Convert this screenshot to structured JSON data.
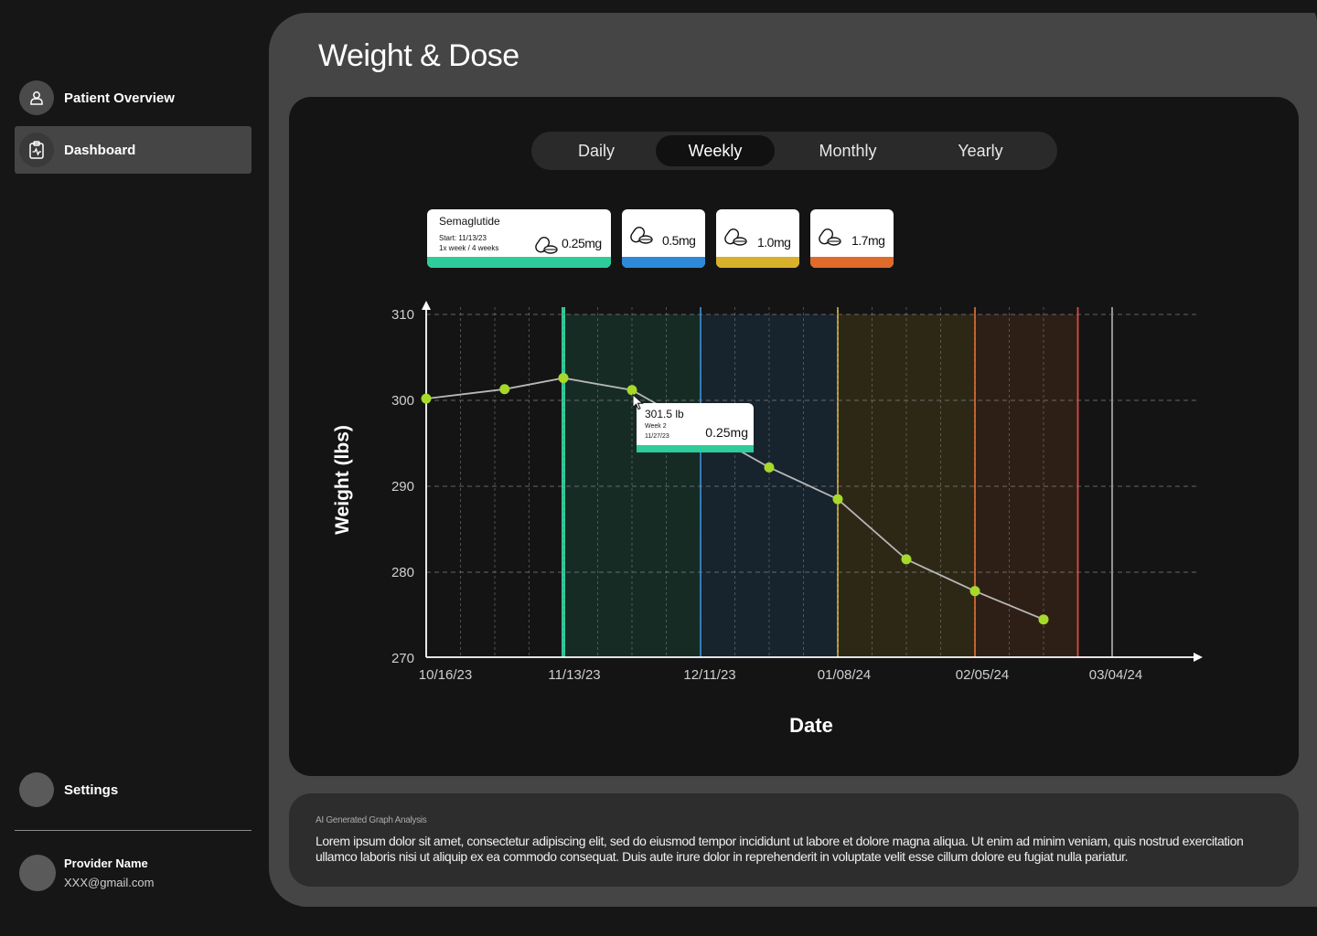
{
  "sidebar": {
    "items": [
      {
        "label": "Patient Overview",
        "icon": "person-icon"
      },
      {
        "label": "Dashboard",
        "icon": "clipboard-icon"
      }
    ],
    "settings_label": "Settings",
    "provider": {
      "name": "Provider Name",
      "email": "XXX@gmail.com"
    }
  },
  "page": {
    "title": "Weight & Dose"
  },
  "tabs": [
    {
      "label": "Daily",
      "active": false
    },
    {
      "label": "Weekly",
      "active": true
    },
    {
      "label": "Monthly",
      "active": false
    },
    {
      "label": "Yearly",
      "active": false
    }
  ],
  "doses": {
    "drug": "Semaglutide",
    "start": "Start: 11/13/23",
    "schedule": "1x week / 4 weeks",
    "levels": [
      {
        "amount": "0.25mg",
        "color": "#2ecc9a"
      },
      {
        "amount": "0.5mg",
        "color": "#2d8ad8"
      },
      {
        "amount": "1.0mg",
        "color": "#d8b02a"
      },
      {
        "amount": "1.7mg",
        "color": "#e06a2a"
      }
    ]
  },
  "chart_data": {
    "type": "line",
    "xlabel": "Date",
    "ylabel": "Weight (lbs)",
    "x_ticks": [
      "10/16/23",
      "11/13/23",
      "12/11/23",
      "01/08/24",
      "02/05/24",
      "03/04/24"
    ],
    "y_ticks": [
      270,
      280,
      290,
      300,
      310
    ],
    "ylim": [
      270,
      310
    ],
    "grid": true,
    "series": [
      {
        "x": [
          "10/16/23",
          "10/23/23",
          "10/30/23",
          "11/06/23",
          "11/13/23",
          "11/20/23",
          "11/27/23",
          "12/04/23",
          "12/11/23",
          "12/18/23",
          "12/25/23",
          "01/01/24",
          "01/08/24",
          "01/15/24",
          "01/22/24",
          "01/29/24",
          "02/05/24",
          "02/12/24",
          "02/19/24",
          "02/26/24",
          "03/04/24"
        ],
        "points": [
          {
            "x": "10/16/23",
            "y": 300.2
          },
          {
            "x": "11/01/23",
            "y": 301.3
          },
          {
            "x": "11/13/23",
            "y": 302.6
          },
          {
            "x": "11/27/23",
            "y": 301.2
          },
          {
            "x": "12/25/23",
            "y": 292.2
          },
          {
            "x": "01/08/24",
            "y": 288.5
          },
          {
            "x": "01/22/24",
            "y": 281.5
          },
          {
            "x": "02/05/24",
            "y": 277.8
          },
          {
            "x": "02/19/24",
            "y": 274.5
          }
        ],
        "color": "#a6d92a"
      }
    ],
    "dose_bands": [
      {
        "start": "11/13/23",
        "end": "12/11/23",
        "dose": "0.25mg",
        "color": "#2ecc9a"
      },
      {
        "start": "12/11/23",
        "end": "01/08/24",
        "dose": "0.5mg",
        "color": "#2d8ad8"
      },
      {
        "start": "01/08/24",
        "end": "02/05/24",
        "dose": "1.0mg",
        "color": "#d8b02a"
      },
      {
        "start": "02/05/24",
        "end": "02/26/24",
        "dose": "1.7mg",
        "color": "#e06a2a"
      }
    ],
    "tooltip": {
      "weight": "301.5 lb",
      "week": "Week 2",
      "date": "11/27/23",
      "dose": "0.25mg"
    }
  },
  "analysis": {
    "label": "AI Generated Graph Analysis",
    "text": "Lorem ipsum dolor sit amet, consectetur adipiscing elit, sed do eiusmod tempor incididunt ut labore et dolore magna aliqua. Ut enim ad minim veniam, quis nostrud exercitation ullamco laboris nisi ut aliquip ex ea commodo consequat. Duis aute irure dolor in reprehenderit in voluptate velit esse cillum dolore eu fugiat nulla pariatur."
  }
}
